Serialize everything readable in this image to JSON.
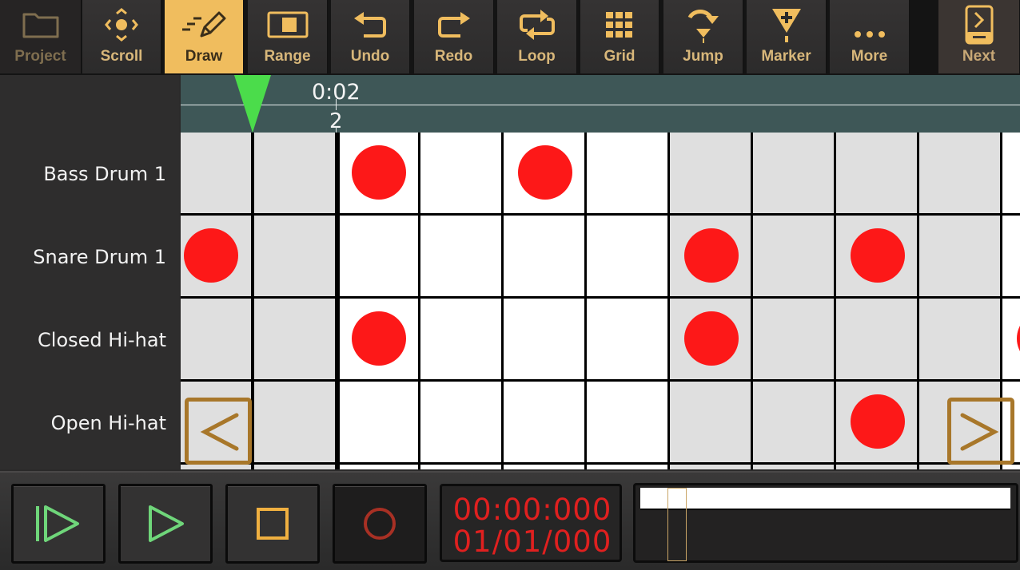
{
  "toolbar": {
    "buttons": [
      {
        "id": "project",
        "label": "Project",
        "icon": "folder-icon",
        "state": "disabled"
      },
      {
        "id": "scroll",
        "label": "Scroll",
        "icon": "scroll-arrows-icon",
        "state": "normal"
      },
      {
        "id": "draw",
        "label": "Draw",
        "icon": "pencil-icon",
        "state": "active"
      },
      {
        "id": "range",
        "label": "Range",
        "icon": "range-select-icon",
        "state": "normal"
      },
      {
        "id": "undo",
        "label": "Undo",
        "icon": "undo-icon",
        "state": "normal"
      },
      {
        "id": "redo",
        "label": "Redo",
        "icon": "redo-icon",
        "state": "normal"
      },
      {
        "id": "loop",
        "label": "Loop",
        "icon": "loop-icon",
        "state": "normal"
      },
      {
        "id": "grid",
        "label": "Grid",
        "icon": "grid-icon",
        "state": "normal"
      },
      {
        "id": "jump",
        "label": "Jump",
        "icon": "jump-icon",
        "state": "normal"
      },
      {
        "id": "marker",
        "label": "Marker",
        "icon": "add-marker-icon",
        "state": "normal"
      },
      {
        "id": "more",
        "label": "More",
        "icon": "more-dots-icon",
        "state": "normal"
      },
      {
        "id": "next",
        "label": "Next",
        "icon": "next-page-icon",
        "state": "normal"
      }
    ]
  },
  "ruler": {
    "time_label": "0:02",
    "bar_label": "2"
  },
  "tracks": [
    {
      "name": "Bass Drum 1",
      "notes": [
        2,
        4
      ]
    },
    {
      "name": "Snare Drum 1",
      "notes": [
        0,
        6,
        8
      ]
    },
    {
      "name": "Closed Hi-hat",
      "notes": [
        2,
        6,
        10
      ]
    },
    {
      "name": "Open Hi-hat",
      "notes": [
        8
      ]
    }
  ],
  "grid_nav": {
    "prev_label": "<",
    "next_label": ">"
  },
  "transport": {
    "play_from_start": "play-from-start-icon",
    "play": "play-icon",
    "stop": "stop-icon",
    "record": "record-icon",
    "time": "00:00:000",
    "position": "01/01/000"
  },
  "colors": {
    "accent": "#f0bd5e",
    "note": "#fd1818",
    "playhead": "#4bdc4b",
    "ruler": "#3e5757",
    "lcd_text": "#e0201f",
    "transport_green": "#6fd67a",
    "nav_arrow": "#a8772a"
  }
}
